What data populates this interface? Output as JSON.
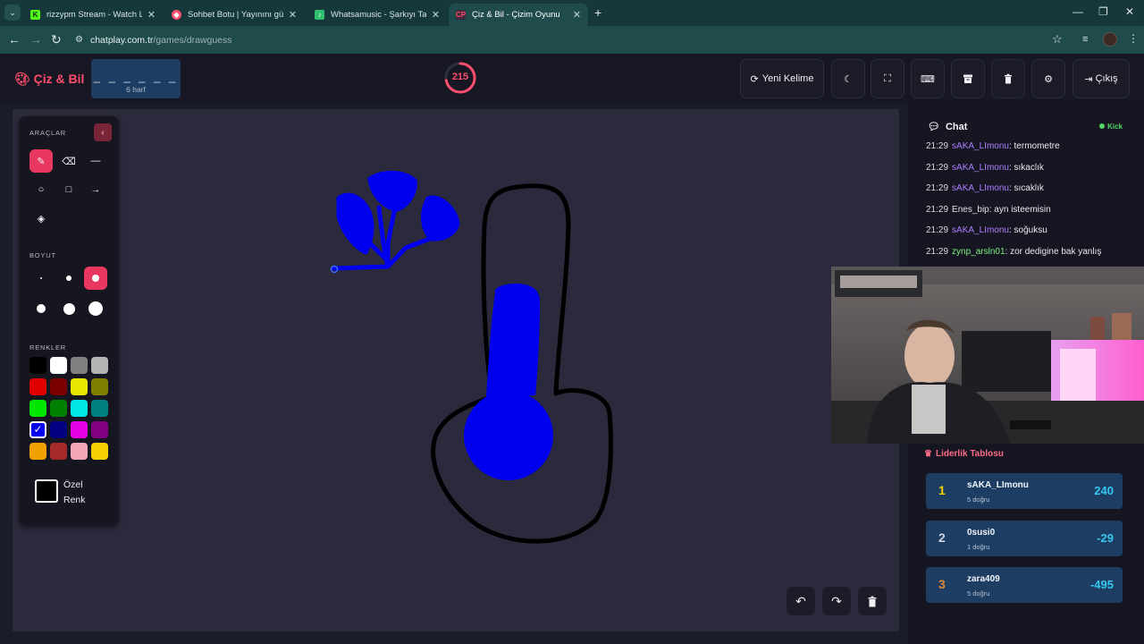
{
  "browser": {
    "tabs": [
      {
        "title": "rizzypm Stream - Watch Live on Kick",
        "favicon": "kick-icon",
        "color": "#53fc18"
      },
      {
        "title": "Sohbet Botu | Yayınını güçlendir",
        "favicon": "bot-icon",
        "color": "#ff4d6d"
      },
      {
        "title": "Whatsamusic - Şarkıyı Tahmin Et",
        "favicon": "music-icon",
        "color": "#2fbf71"
      },
      {
        "title": "Çiz & Bil - Çizim Oyunu",
        "favicon": "paint-icon",
        "color": "#ff4d6d"
      }
    ],
    "url_host": "chatplay.com.tr",
    "url_path": "/games/drawguess"
  },
  "header": {
    "logo": "Çiz & Bil",
    "word_mask": "_ _ _ _ _ _",
    "word_length": "6 harf",
    "timer": "215",
    "timer_fraction": 0.72,
    "new_word_label": "Yeni Kelime",
    "exit_label": "Çıkış"
  },
  "tools": {
    "section_tools": "ARAÇLAR",
    "section_size": "BOYUT",
    "section_colors": "RENKLER",
    "custom_color_label": "Özel Renk",
    "selected_tool": "pencil",
    "selected_color": "#0000ee",
    "palette": [
      "#000000",
      "#ffffff",
      "#808080",
      "#b3b3b3",
      "#e00000",
      "#7a0000",
      "#e6e600",
      "#808000",
      "#00e600",
      "#008000",
      "#00e6e6",
      "#008080",
      "#0000ee",
      "#000080",
      "#e600e6",
      "#800080",
      "#f0a000",
      "#a52a2a",
      "#f4a6b8",
      "#f5d000"
    ]
  },
  "chat": {
    "title": "Chat",
    "platform": "Kick",
    "messages": [
      {
        "time": "21:29",
        "user": "sAKA_LImonu",
        "text": ": termometre",
        "color": "#b07cff"
      },
      {
        "time": "21:29",
        "user": "sAKA_LImonu",
        "text": ": sıkaclık",
        "color": "#b07cff"
      },
      {
        "time": "21:29",
        "user": "sAKA_LImonu",
        "text": ": sıcaklık",
        "color": "#b07cff"
      },
      {
        "time": "21:29",
        "user": "Enes_bip",
        "text": ": ayn isteemisin",
        "color": "#e0e0e8"
      },
      {
        "time": "21:29",
        "user": "sAKA_LImonu",
        "text": ": soğuksu",
        "color": "#b07cff"
      },
      {
        "time": "21:29",
        "user": "zynp_arsln01",
        "text": ": zor dedigine bak yanlış",
        "color": "#7cf07c"
      }
    ]
  },
  "leaderboard": {
    "title": "Liderlik Tablosu",
    "entries": [
      {
        "rank": "1",
        "name": "sAKA_LImonu",
        "correct": "5 doğru",
        "score": "240",
        "rank_color": "#f5d000"
      },
      {
        "rank": "2",
        "name": "0susi0",
        "correct": "1 doğru",
        "score": "-29",
        "rank_color": "#d0d4dc"
      },
      {
        "rank": "3",
        "name": "zara409",
        "correct": "5 doğru",
        "score": "-495",
        "rank_color": "#e08a3c"
      }
    ]
  }
}
